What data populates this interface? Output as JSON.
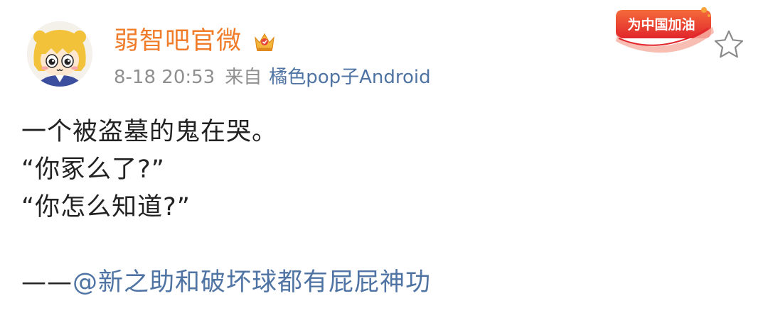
{
  "post": {
    "author": {
      "name": "弱智吧官微",
      "avatar": "avatar",
      "badge_icon": "crown-icon"
    },
    "time": "8-18 20:53",
    "from_label": "来自",
    "source": "橘色pop子Android",
    "campaign_badge": "为中国加油",
    "favorite_icon": "star-icon",
    "content": {
      "line1": "一个被盗墓的鬼在哭。",
      "line2": "“你冢么了?”",
      "line3": "“你怎么知道?”",
      "signature_prefix": "——",
      "signature_mention": "@新之助和破坏球都有屁屁神功"
    }
  },
  "colors": {
    "username": "#f07c2a",
    "link": "#4f74a3",
    "meta": "#8f8f8f",
    "text": "#222222",
    "badge": "#e63b2e"
  }
}
